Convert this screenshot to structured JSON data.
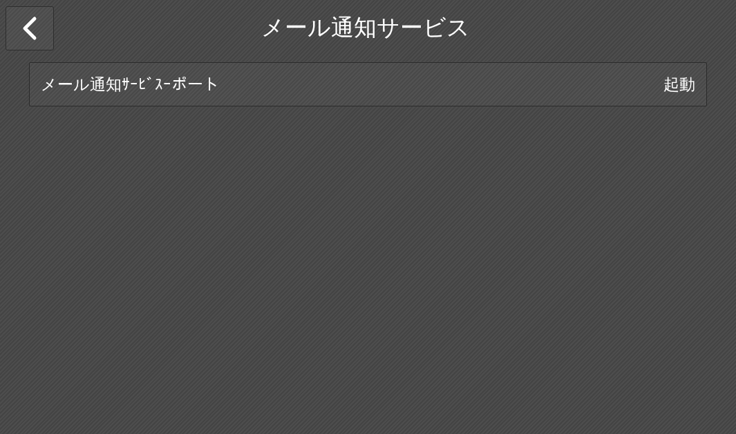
{
  "header": {
    "title": "メール通知サービス"
  },
  "settings": [
    {
      "label": "メール通知ｻｰﾋﾞｽｰポート",
      "value": "起動"
    }
  ]
}
